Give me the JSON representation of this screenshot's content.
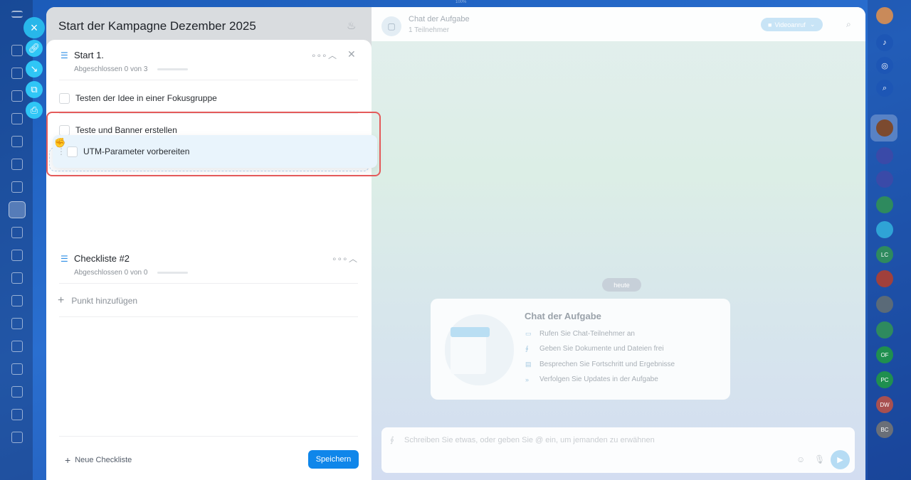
{
  "top_hint": "100%",
  "task": {
    "title": "Start der Kampagne Dezember 2025"
  },
  "checklists": [
    {
      "title": "Start 1.",
      "progress_text": "Abgeschlossen 0 von 3",
      "items": [
        {
          "label": "Testen der Idee in einer Fokusgruppe"
        },
        {
          "label": "Teste und Banner erstellen"
        }
      ],
      "dragging_item": {
        "label": "UTM-Parameter vorbereiten"
      }
    },
    {
      "title": "Checkliste #2",
      "progress_text": "Abgeschlossen 0 von 0",
      "add_item_label": "Punkt hinzufügen"
    }
  ],
  "footer": {
    "new_checklist_label": "Neue Checkliste",
    "save_label": "Speichern"
  },
  "chat": {
    "title": "Chat der Aufgabe",
    "members": "1 Teilnehmer",
    "video_button": "Videoanruf",
    "date_pill": "heute",
    "welcome": {
      "title": "Chat der Aufgabe",
      "rows": [
        {
          "icon": "camera-icon",
          "text": "Rufen Sie Chat-Teilnehmer an"
        },
        {
          "icon": "paperclip-icon",
          "text": "Geben Sie Dokumente und Dateien frei"
        },
        {
          "icon": "chat-bubble-icon",
          "text": "Besprechen Sie Fortschritt und Ergebnisse"
        },
        {
          "icon": "arrows-icon",
          "text": "Verfolgen Sie Updates in der Aufgabe"
        }
      ]
    },
    "composer_placeholder": "Schreiben Sie etwas, oder geben Sie @ ein, um jemanden zu erwähnen"
  },
  "right_rail": {
    "avatars": [
      {
        "initials": "",
        "color": "#7c4a2f"
      },
      {
        "initials": "",
        "color": "#3a4aa8"
      },
      {
        "initials": "",
        "color": "#3a4aa8"
      },
      {
        "initials": "",
        "color": "#2e8a5e"
      },
      {
        "initials": "",
        "color": "#2fa3d6"
      },
      {
        "initials": "LC",
        "color": "#2e8a5e"
      },
      {
        "initials": "",
        "color": "#a0403c"
      },
      {
        "initials": "",
        "color": "#5a6a78"
      },
      {
        "initials": "",
        "color": "#2e8a5e"
      },
      {
        "initials": "OF",
        "color": "#1f8f4f"
      },
      {
        "initials": "PC",
        "color": "#1f8f4f"
      },
      {
        "initials": "DW",
        "color": "#a85050"
      },
      {
        "initials": "BC",
        "color": "#6a6f78"
      }
    ]
  },
  "colors": {
    "accent": "#0f86ea",
    "highlight": "#e45a5a",
    "fab": "#2fc6f6"
  }
}
